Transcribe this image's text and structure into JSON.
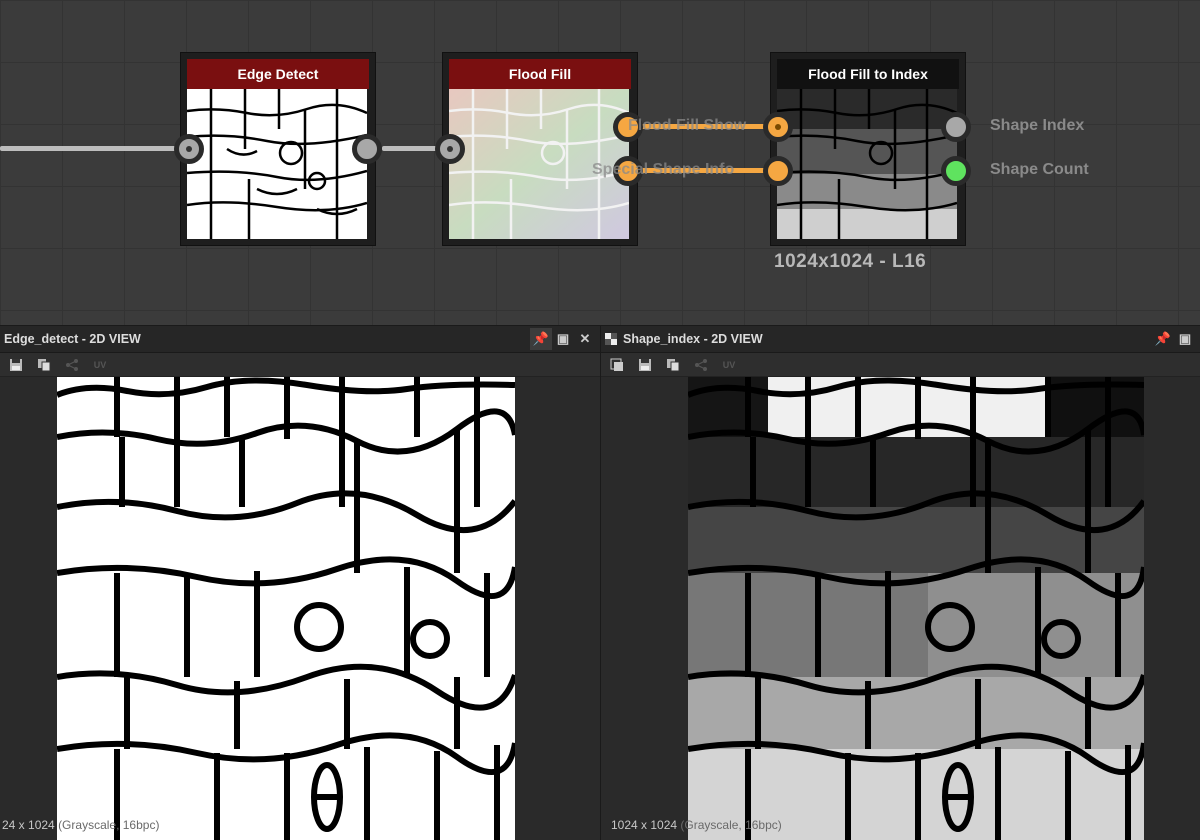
{
  "graph": {
    "nodes": [
      {
        "id": "edge",
        "title": "Edge Detect"
      },
      {
        "id": "flood",
        "title": "Flood Fill"
      },
      {
        "id": "index",
        "title": "Flood Fill to Index",
        "info": "1024x1024 - L16"
      }
    ],
    "flood_fill_to_index": {
      "input_labels": [
        "Flood Fill Show",
        "Special Shape Info"
      ],
      "output_labels": [
        "Shape Index",
        "Shape Count"
      ]
    },
    "colors": {
      "node_header": "#7a0f10",
      "wire_main": "#bdbdbd",
      "port_orange": "#f5a742",
      "port_green": "#5fe35f"
    }
  },
  "panels": {
    "left": {
      "title": "Edge_detect - 2D VIEW",
      "status_main": "24 x 1024",
      "status_muted": "(Grayscale, 16bpc)"
    },
    "right": {
      "title": "Shape_index - 2D VIEW",
      "status_main": "1024 x 1024",
      "status_muted": "(Grayscale, 16bpc)"
    }
  }
}
